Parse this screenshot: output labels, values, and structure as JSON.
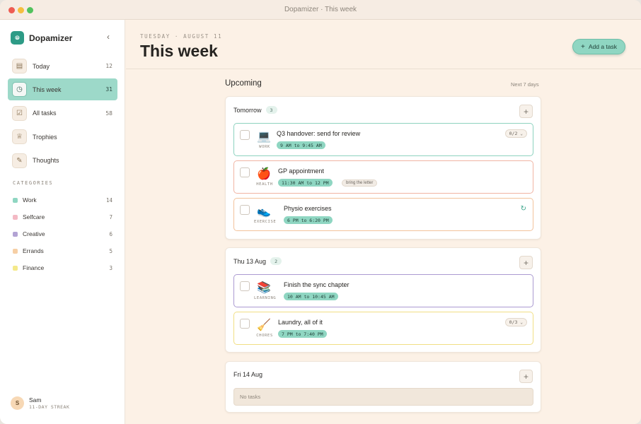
{
  "window": {
    "title": "Dopamizer · This week"
  },
  "brand": {
    "logo": "⦾",
    "name": "Dopamizer",
    "collapse_icon": "chevron-left-icon"
  },
  "nav": [
    {
      "label": "Today",
      "count": "12",
      "icon": "calendar-icon",
      "glyph": "▤",
      "active": false
    },
    {
      "label": "This week",
      "count": "31",
      "icon": "clock-icon",
      "glyph": "◷",
      "active": true
    },
    {
      "label": "All tasks",
      "count": "58",
      "icon": "checklist-icon",
      "glyph": "☑",
      "active": false
    },
    {
      "label": "Trophies",
      "count": "",
      "icon": "trophy-icon",
      "glyph": "♕",
      "active": false
    },
    {
      "label": "Thoughts",
      "count": "",
      "icon": "lightbulb-icon",
      "glyph": "✎",
      "active": false
    }
  ],
  "categories_heading": "CATEGORIES",
  "categories": [
    {
      "label": "Work",
      "count": "14",
      "color": "#8fd6c2"
    },
    {
      "label": "Selfcare",
      "count": "7",
      "color": "#f3b9c4"
    },
    {
      "label": "Creative",
      "count": "6",
      "color": "#b3a3d4"
    },
    {
      "label": "Errands",
      "count": "5",
      "color": "#f6cfa5"
    },
    {
      "label": "Finance",
      "count": "3",
      "color": "#f4e98a"
    }
  ],
  "user": {
    "initial": "S",
    "name": "Sam",
    "streak": "11-DAY STREAK"
  },
  "header": {
    "date": "TUESDAY · AUGUST 11",
    "title": "This week",
    "add_label": "Add a task",
    "add_icon": "+"
  },
  "section": {
    "title": "Upcoming",
    "subtitle": "Next 7 days"
  },
  "days": [
    {
      "name": "Tomorrow",
      "count": "3",
      "tasks": [
        {
          "title": "Q3 handover: send for review",
          "category": "WORK",
          "time": "9 AM to 9:45 AM",
          "icon": "laptop-icon",
          "glyph": "💻",
          "subtasks": "0/2"
        },
        {
          "title": "GP appointment",
          "category": "HEALTH",
          "time": "11:30 AM to 12 PM",
          "icon": "apple-icon",
          "glyph": "🍎",
          "note": "bring the letter"
        },
        {
          "title": "Physio exercises",
          "category": "EXERCISE",
          "time": "6 PM to 6:20 PM",
          "icon": "sneaker-icon",
          "glyph": "👟",
          "repeat_icon": "repeat-icon"
        }
      ]
    },
    {
      "name": "Thu 13 Aug",
      "count": "2",
      "tasks": [
        {
          "title": "Finish the sync chapter",
          "category": "LEARNING",
          "time": "10 AM to 10:45 AM",
          "icon": "books-icon",
          "glyph": "📚"
        },
        {
          "title": "Laundry, all of it",
          "category": "CHORES",
          "time": "7 PM to 7:40 PM",
          "icon": "broom-icon",
          "glyph": "🧹",
          "subtasks": "0/3"
        }
      ]
    },
    {
      "name": "Fri 14 Aug",
      "count": "",
      "empty": "No tasks"
    }
  ]
}
